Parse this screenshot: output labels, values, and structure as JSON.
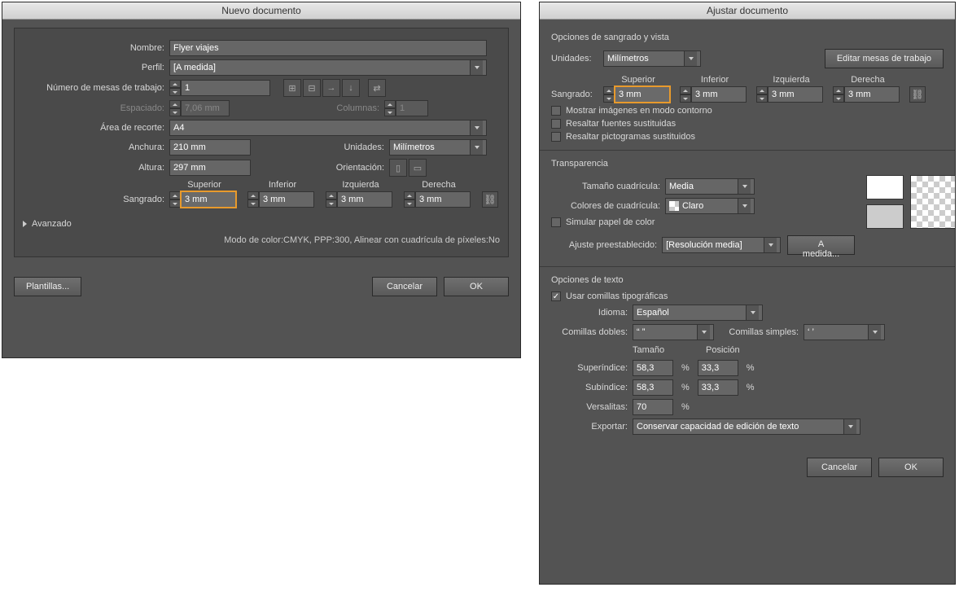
{
  "newDoc": {
    "title": "Nuevo documento",
    "nameLbl": "Nombre:",
    "name": "Flyer viajes",
    "profileLbl": "Perfil:",
    "profile": "[A medida]",
    "artboardsLbl": "Número de mesas de trabajo:",
    "artboards": "1",
    "spacingLbl": "Espaciado:",
    "spacing": "7,06 mm",
    "columnsLbl": "Columnas:",
    "columns": "1",
    "cropLbl": "Área de recorte:",
    "crop": "A4",
    "widthLbl": "Anchura:",
    "width": "210 mm",
    "unitsLbl": "Unidades:",
    "units": "Milímetros",
    "heightLbl": "Altura:",
    "height": "297 mm",
    "orientLbl": "Orientación:",
    "bleedLbl": "Sangrado:",
    "bleed": {
      "topLbl": "Superior",
      "bottomLbl": "Inferior",
      "leftLbl": "Izquierda",
      "rightLbl": "Derecha",
      "top": "3 mm",
      "bottom": "3 mm",
      "left": "3 mm",
      "right": "3 mm"
    },
    "advanced": "Avanzado",
    "footerInfo": "Modo de color:CMYK, PPP:300, Alinear con cuadrícula de píxeles:No",
    "templates": "Plantillas...",
    "cancel": "Cancelar",
    "ok": "OK"
  },
  "adjust": {
    "title": "Ajustar documento",
    "secBleed": "Opciones de sangrado y vista",
    "unitsLbl": "Unidades:",
    "units": "Milímetros",
    "editArtboards": "Editar mesas de trabajo",
    "bleedLbl": "Sangrado:",
    "bleed": {
      "topLbl": "Superior",
      "bottomLbl": "Inferior",
      "leftLbl": "Izquierda",
      "rightLbl": "Derecha",
      "top": "3 mm",
      "bottom": "3 mm",
      "left": "3 mm",
      "right": "3 mm"
    },
    "chkOutline": "Mostrar imágenes en modo contorno",
    "chkFonts": "Resaltar fuentes sustituidas",
    "chkGlyphs": "Resaltar pictogramas sustituidos",
    "secTrans": "Transparencia",
    "gridSizeLbl": "Tamaño cuadrícula:",
    "gridSize": "Media",
    "gridColorLbl": "Colores de cuadrícula:",
    "gridColor": "Claro",
    "chkSimPaper": "Simular papel de color",
    "presetLbl": "Ajuste preestablecido:",
    "preset": "[Resolución media]",
    "custom": "A medida...",
    "secText": "Opciones de texto",
    "chkQuotes": "Usar comillas tipográficas",
    "langLbl": "Idioma:",
    "lang": "Español",
    "dblQuoteLbl": "Comillas dobles:",
    "dblQuote": "“ ”",
    "sngQuoteLbl": "Comillas simples:",
    "sngQuote": "‘ ’",
    "sizeLbl": "Tamaño",
    "posLbl": "Posición",
    "superLbl": "Superíndice:",
    "superSize": "58,3",
    "superPos": "33,3",
    "subLbl": "Subíndice:",
    "subSize": "58,3",
    "subPos": "33,3",
    "smallCapsLbl": "Versalitas:",
    "smallCaps": "70",
    "pct": "%",
    "exportLbl": "Exportar:",
    "export": "Conservar capacidad de edición de texto",
    "cancel": "Cancelar",
    "ok": "OK"
  }
}
